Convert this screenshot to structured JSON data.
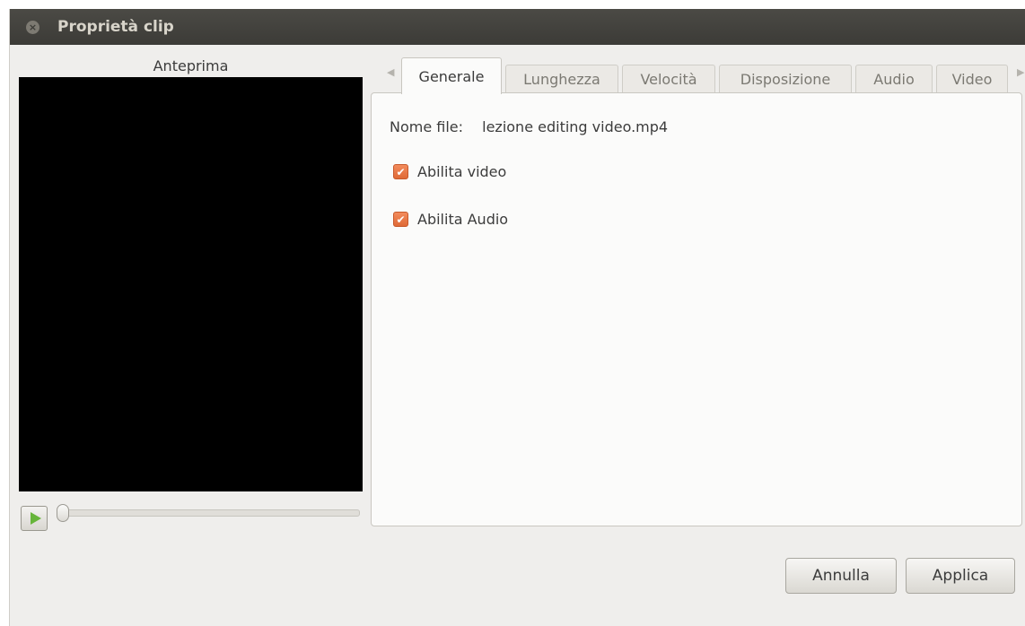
{
  "window": {
    "title": "Proprietà clip",
    "close_icon": "×"
  },
  "preview": {
    "label": "Anteprima",
    "progress": 0
  },
  "tabs": [
    {
      "label": "Generale",
      "active": true
    },
    {
      "label": "Lunghezza",
      "active": false
    },
    {
      "label": "Velocità",
      "active": false
    },
    {
      "label": "Disposizione",
      "active": false
    },
    {
      "label": "Audio",
      "active": false
    },
    {
      "label": "Video",
      "active": false
    }
  ],
  "general": {
    "filename_label": "Nome file:",
    "filename_value": "lezione editing video.mp4",
    "enable_video_label": "Abilita video",
    "enable_video_checked": true,
    "enable_audio_label": "Abilita Audio",
    "enable_audio_checked": true
  },
  "buttons": {
    "cancel": "Annulla",
    "apply": "Applica"
  },
  "colors": {
    "accent": "#df6a37",
    "play": "#67b53a",
    "titlebar": "#3c3b37"
  }
}
